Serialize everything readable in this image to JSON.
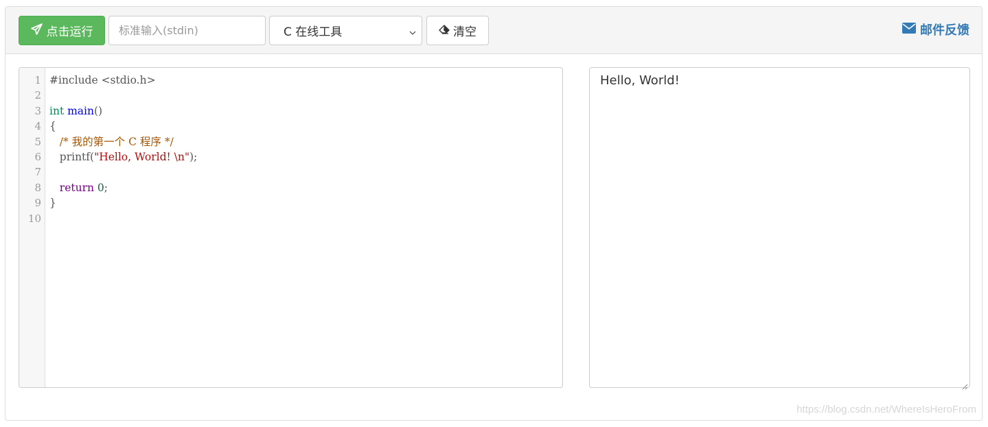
{
  "toolbar": {
    "run_label": "点击运行",
    "stdin_placeholder": "标准输入(stdin)",
    "language_selected": "C 在线工具",
    "clear_label": "清空",
    "feedback_label": "邮件反馈"
  },
  "editor": {
    "line_numbers": [
      "1",
      "2",
      "3",
      "4",
      "5",
      "6",
      "7",
      "8",
      "9",
      "10"
    ],
    "lines": [
      [
        {
          "t": "#include <stdio.h>",
          "c": "meta"
        }
      ],
      [],
      [
        {
          "t": "int",
          "c": "type"
        },
        {
          "t": " ",
          "c": "plain"
        },
        {
          "t": "main",
          "c": "def"
        },
        {
          "t": "()",
          "c": "plain"
        }
      ],
      [
        {
          "t": "{",
          "c": "plain"
        }
      ],
      [
        {
          "t": "   ",
          "c": "plain"
        },
        {
          "t": "/* 我的第一个 C 程序 */",
          "c": "comment"
        }
      ],
      [
        {
          "t": "   printf(",
          "c": "plain"
        },
        {
          "t": "\"Hello, World! \\n\"",
          "c": "string"
        },
        {
          "t": ");",
          "c": "plain"
        }
      ],
      [],
      [
        {
          "t": "   ",
          "c": "plain"
        },
        {
          "t": "return",
          "c": "keyword"
        },
        {
          "t": " ",
          "c": "plain"
        },
        {
          "t": "0",
          "c": "number"
        },
        {
          "t": ";",
          "c": "plain"
        }
      ],
      [
        {
          "t": "}",
          "c": "plain"
        }
      ],
      []
    ]
  },
  "output": {
    "text": "Hello, World!"
  },
  "watermark": "https://blog.csdn.net/WhereIsHeroFrom",
  "colors": {
    "run_button": "#5cb85c",
    "link": "#337ab7"
  },
  "icons": {
    "run": "paper-plane-icon",
    "clear": "eraser-icon",
    "feedback": "envelope-icon",
    "select": "chevron-down-icon"
  }
}
